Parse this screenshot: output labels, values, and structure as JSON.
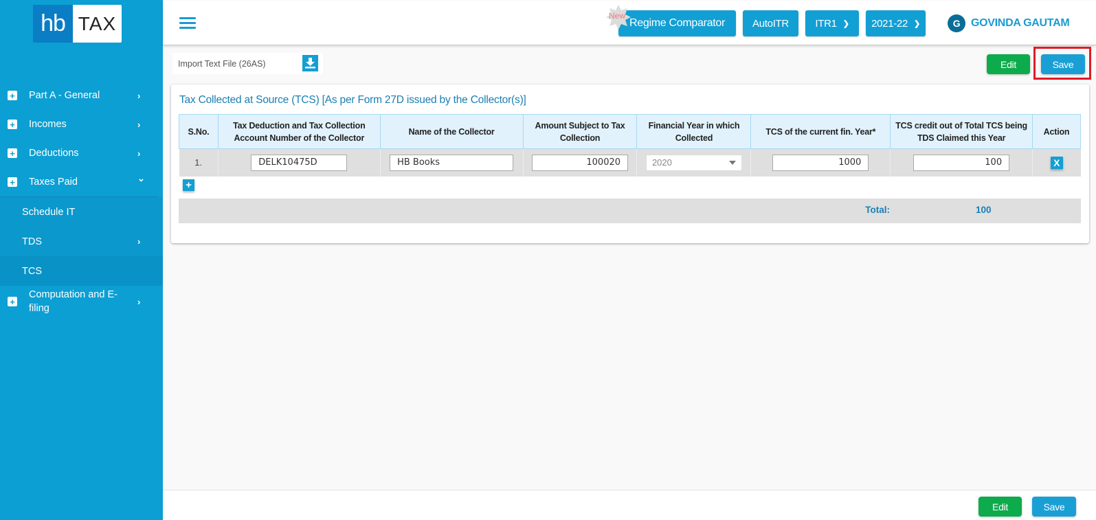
{
  "logo": {
    "left": "hb",
    "right": "TAX"
  },
  "sidebar": {
    "items": [
      {
        "label": "Part A - General",
        "chevron": "›"
      },
      {
        "label": "Incomes",
        "chevron": "›"
      },
      {
        "label": "Deductions",
        "chevron": "›"
      },
      {
        "label": "Taxes Paid",
        "chevron": "⌄"
      }
    ],
    "sub_items": [
      {
        "label": "Schedule IT"
      },
      {
        "label": "TDS",
        "chevron": "›"
      },
      {
        "label": "TCS",
        "active": true
      }
    ],
    "last_item": {
      "label": "Computation and E-filing",
      "chevron": "›"
    },
    "plus_glyph": "+"
  },
  "topbar": {
    "new_badge": "New",
    "regime_button": "Regime Comparator",
    "autoitr_button": "AutoITR",
    "itr_select": "ITR1",
    "year_select": "2021-22",
    "caret": "⌄",
    "user_initial": "G",
    "user_name": "GOVINDA GAUTAM"
  },
  "toolbar": {
    "import_label": "Import Text File (26AS)",
    "edit_label": "Edit",
    "save_label": "Save"
  },
  "section": {
    "title": "Tax Collected at Source (TCS) [As per Form 27D issued by the Collector(s)]",
    "columns": [
      "S.No.",
      "Tax Deduction and Tax Collection Account Number of the Collector",
      "Name of the Collector",
      "Amount Subject to Tax Collection",
      "Financial Year in which Collected",
      "TCS of the current fin. Year*",
      "TCS credit out of Total TCS being TDS Claimed this Year",
      "Action"
    ],
    "rows": [
      {
        "sno": "1.",
        "tan": "DELK10475D",
        "collector": "HB Books",
        "amount": "100020",
        "fin_year": "2020",
        "tcs_current": "1000",
        "tcs_credit": "100",
        "action": "X"
      }
    ],
    "add_glyph": "+",
    "total_label": "Total:",
    "total_value": "100"
  },
  "footer": {
    "edit_label": "Edit",
    "save_label": "Save"
  },
  "colors": {
    "primary": "#129fd4",
    "sidebar": "#0c9fd3",
    "green": "#0dab4b",
    "highlight": "#e01b24"
  }
}
